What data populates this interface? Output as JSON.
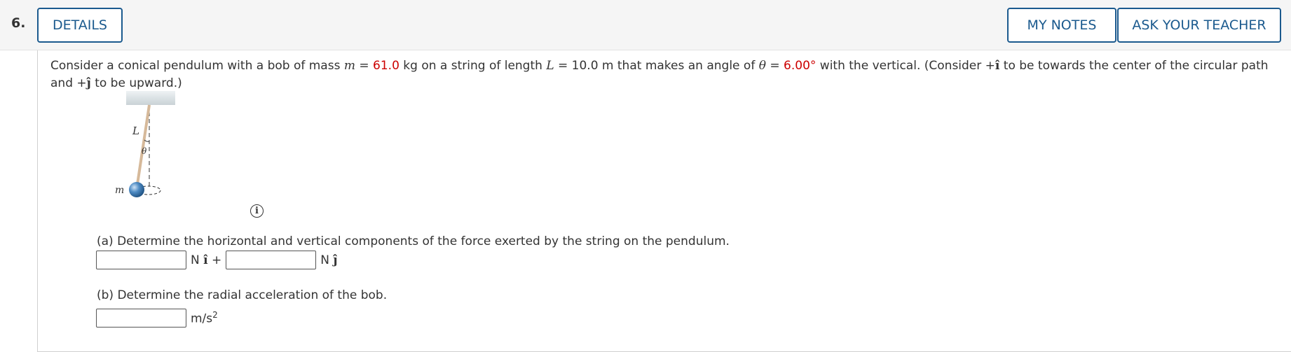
{
  "header": {
    "question_number": "6.",
    "details_label": "DETAILS",
    "my_notes_label": "MY NOTES",
    "ask_teacher_label": "ASK YOUR TEACHER"
  },
  "prompt": {
    "t1": "Consider a conical pendulum with a bob of mass ",
    "m_var": "m",
    "t2": " = ",
    "mass_value": "61.0",
    "t3": " kg on a string of length ",
    "L_var": "L",
    "t4": " = 10.0 m that makes an angle of ",
    "theta_var": "θ",
    "t5": " = ",
    "angle_value": "6.00°",
    "t6": " with the vertical. (Consider +",
    "i_hat": "î",
    "t7": " to be towards the center of the circular path and +",
    "j_hat": "ĵ",
    "t8": " to be upward.)"
  },
  "figure": {
    "label_L": "L",
    "label_theta": "θ",
    "label_m": "m"
  },
  "info_icon": {
    "glyph": "i",
    "icon": "info-icon"
  },
  "part_a": {
    "label": "(a) Determine the horizontal and vertical components of the force exerted by the string on the pendulum.",
    "input1_value": "",
    "unit1_N": "N",
    "unit1_vec": "î",
    "plus": "+",
    "input2_value": "",
    "unit2_N": "N",
    "unit2_vec": "ĵ"
  },
  "part_b": {
    "label": "(b) Determine the radial acceleration of the bob.",
    "input_value": "",
    "unit": "m/s",
    "unit_exp": "2"
  },
  "colors": {
    "accent": "#1b5a8e",
    "given_value": "#cc0000",
    "header_bg": "#f5f5f5"
  }
}
